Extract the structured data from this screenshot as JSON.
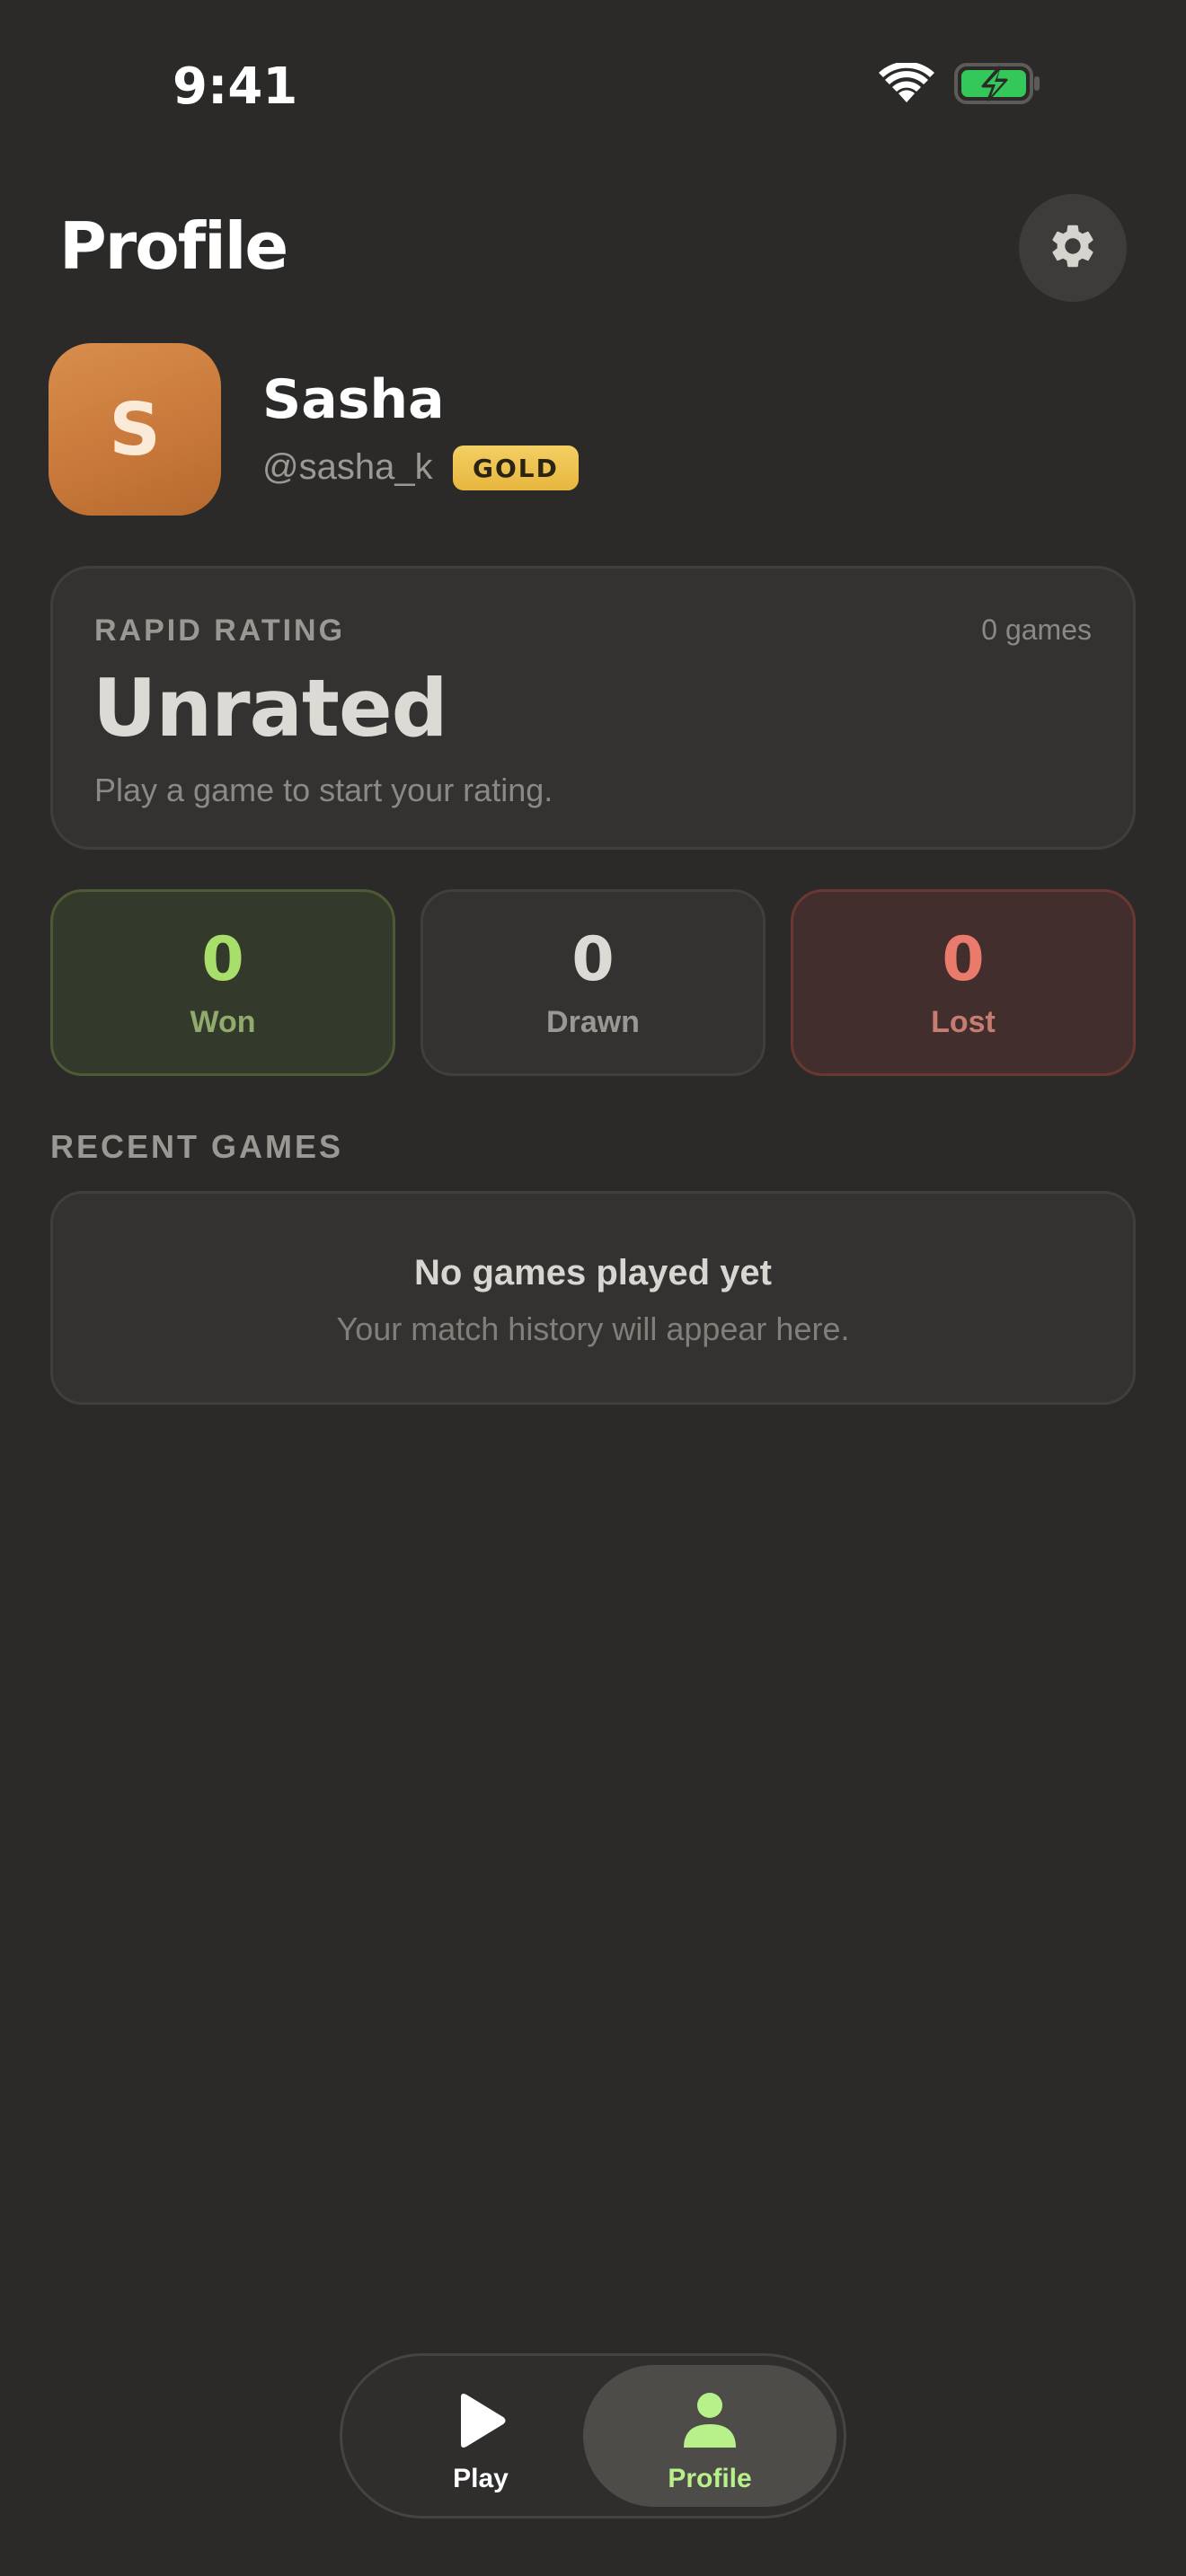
{
  "status_bar": {
    "time": "9:41",
    "wifi_icon": "wifi-icon",
    "battery_icon": "battery-charging-icon",
    "battery_color": "#34c759"
  },
  "header": {
    "title": "Profile",
    "settings_icon": "gear-icon"
  },
  "profile": {
    "avatar_initial": "S",
    "name": "Sasha",
    "handle": "@sasha_k",
    "tier": "GOLD"
  },
  "rating": {
    "label": "RAPID RATING",
    "games_count": "0 games",
    "value": "Unrated",
    "hint": "Play a game to start your rating."
  },
  "stats": {
    "won": {
      "value": "0",
      "label": "Won"
    },
    "drawn": {
      "value": "0",
      "label": "Drawn"
    },
    "lost": {
      "value": "0",
      "label": "Lost"
    }
  },
  "recent_games": {
    "title": "RECENT GAMES",
    "empty_title": "No games played yet",
    "empty_subtitle": "Your match history will appear here."
  },
  "tab_bar": {
    "tabs": [
      {
        "label": "Play",
        "icon": "play-icon",
        "active": false
      },
      {
        "label": "Profile",
        "icon": "person-icon",
        "active": true
      }
    ],
    "active_color": "#b8f08a"
  }
}
